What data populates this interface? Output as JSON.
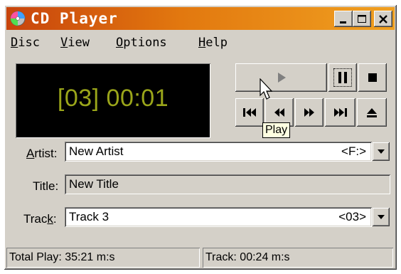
{
  "window": {
    "title": "CD Player"
  },
  "menu": [
    {
      "label": "Disc",
      "mnemonic": "D",
      "rest": "isc"
    },
    {
      "label": "View",
      "mnemonic": "V",
      "rest": "iew"
    },
    {
      "label": "Options",
      "mnemonic": "O",
      "rest": "ptions"
    },
    {
      "label": "Help",
      "mnemonic": "H",
      "rest": "elp"
    }
  ],
  "display": {
    "readout": "[03] 00:01",
    "color": "#9aa51a"
  },
  "controls": {
    "play": "play-icon",
    "pause": "pause-icon",
    "stop": "stop-icon",
    "previous_track": "skip-back-icon",
    "skip_backwards": "rewind-icon",
    "skip_forwards": "fast-forward-icon",
    "next_track": "skip-forward-icon",
    "eject": "eject-icon"
  },
  "fields": {
    "artist": {
      "label_pre": "",
      "label_mnemonic": "A",
      "label_post": "rtist:",
      "value": "New Artist",
      "suffix": "<F:>"
    },
    "title": {
      "label": "Title:",
      "value": "New Title"
    },
    "track": {
      "label_pre": "Trac",
      "label_mnemonic": "k",
      "label_post": ":",
      "value": "Track 3",
      "suffix": "<03>"
    }
  },
  "status": {
    "total_play": "Total Play: 35:21 m:s",
    "track_time": "Track: 00:24 m:s"
  },
  "tooltip": "Play",
  "colors": {
    "titlebar_start": "#c8440c",
    "titlebar_end": "#f0a020",
    "face": "#d4d0c8"
  }
}
